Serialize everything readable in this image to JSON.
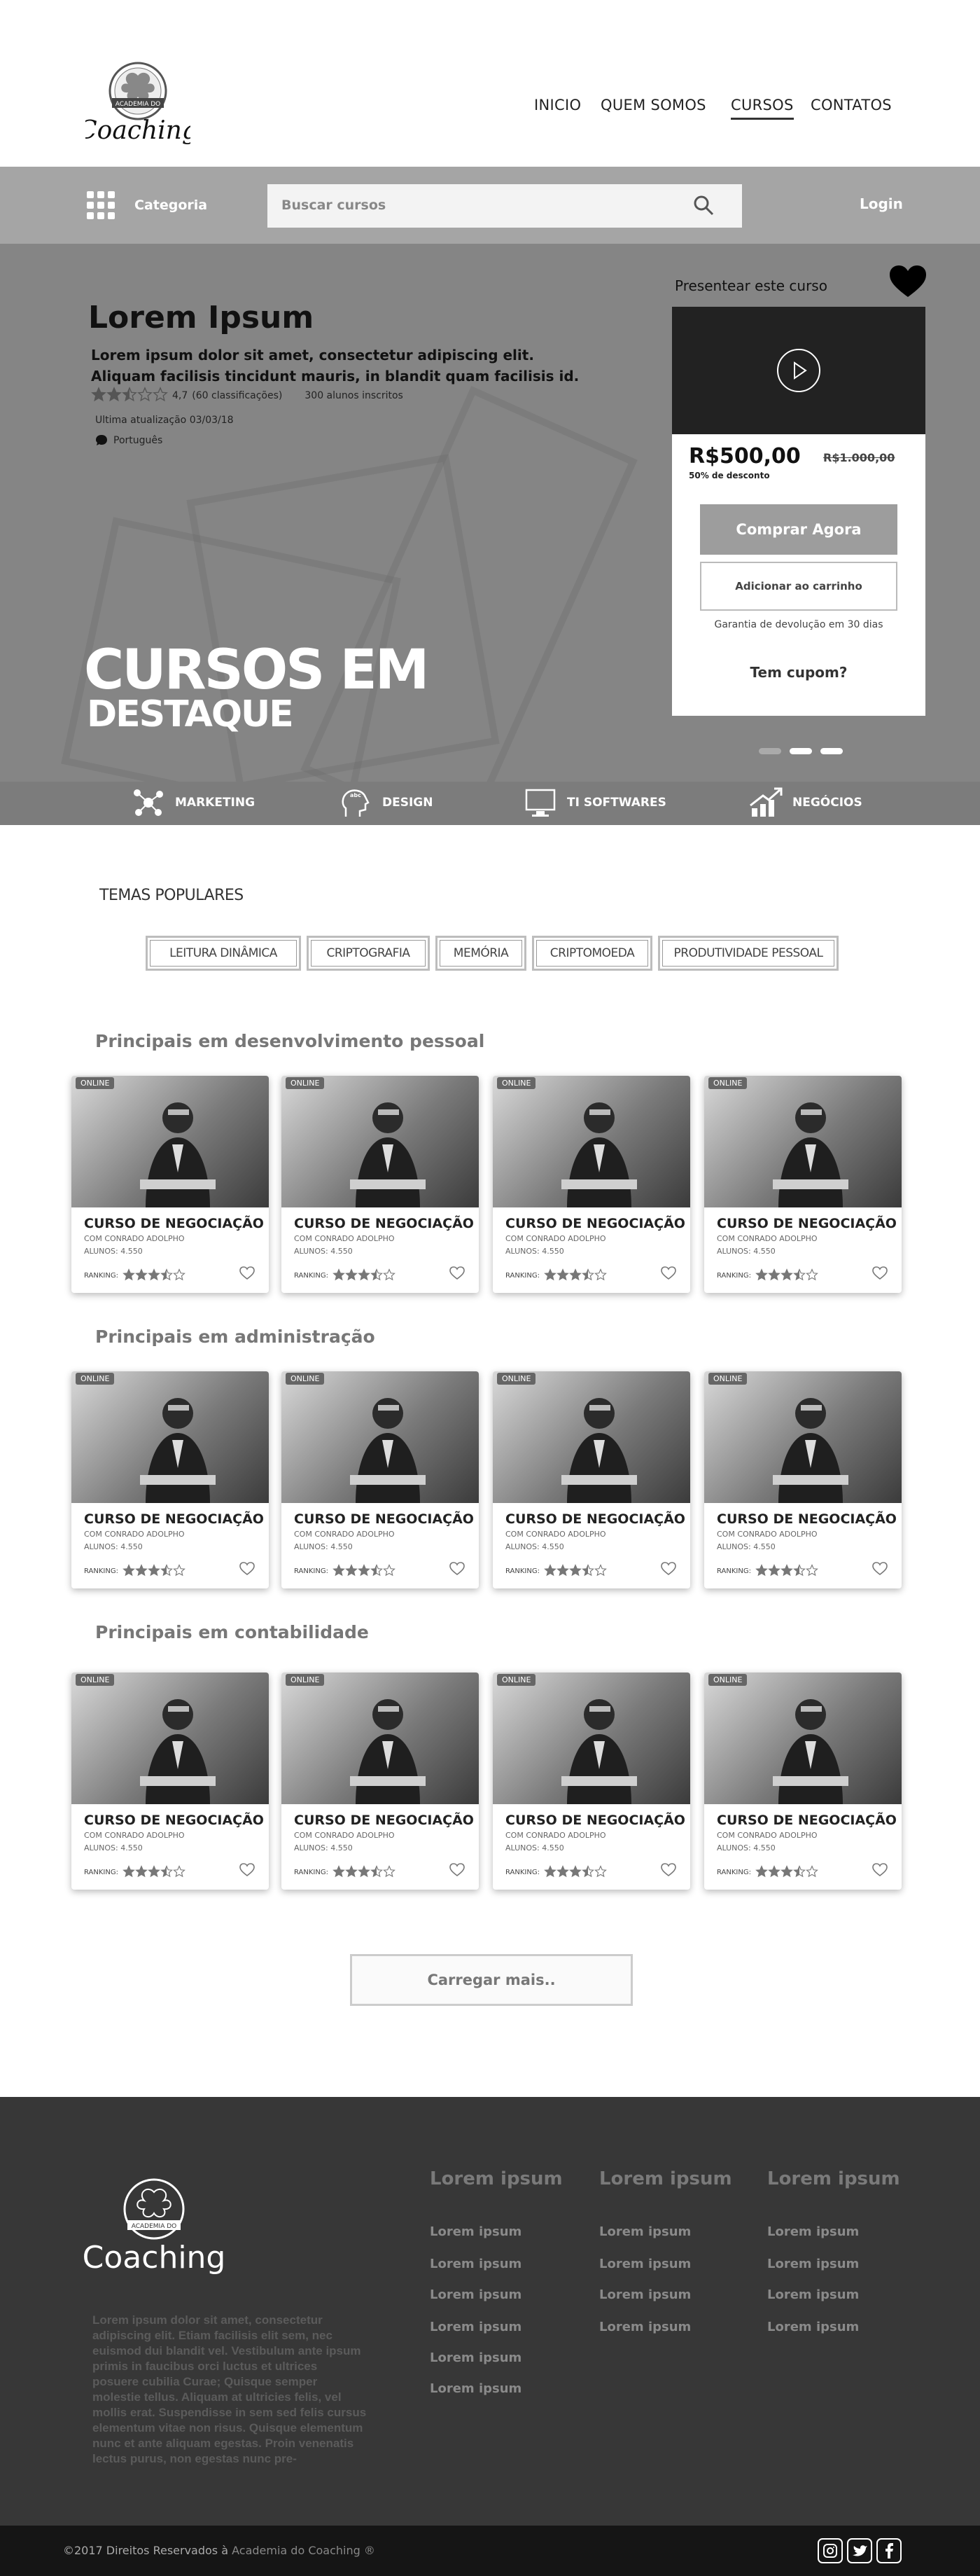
{
  "header": {
    "logo_text": "Coaching",
    "logo_ribbon": "ACADEMIA DO",
    "nav": [
      "INICIO",
      "QUEM SOMOS",
      "CURSOS",
      "CONTATOS"
    ],
    "active_nav": "CURSOS"
  },
  "searchbar": {
    "category_label": "Categoria",
    "search_placeholder": "Buscar cursos",
    "login_label": "Login"
  },
  "hero": {
    "title": "Lorem Ipsum",
    "subtitle": "Lorem ipsum dolor sit amet, consectetur adipiscing elit. Aliquam facilisis tincidunt mauris, in blandit quam facilisis id.",
    "rating_value": "4,7",
    "rating_count": "(60 classificações)",
    "students": "300 alunos inscritos",
    "stars": 2.5,
    "updated": "Ultima atualização 03/03/18",
    "language": "Português",
    "banner_line1": "CURSOS EM",
    "banner_line2": "DESTAQUE"
  },
  "purchase": {
    "gift_label": "Presentear este curso",
    "price": "R$500,00",
    "old_price": "R$1.000,00",
    "discount": "50% de desconto",
    "buy_button": "Comprar Agora",
    "cart_button": "Adicionar ao carrinho",
    "guarantee": "Garantia de devolução em 30 dias",
    "coupon": "Tem cupom?"
  },
  "categories": [
    "MARKETING",
    "DESIGN",
    "TI SOFTWARES",
    "NEGÓCIOS"
  ],
  "popular": {
    "title": "TEMAS POPULARES",
    "tags": [
      "LEITURA DINÂMICA",
      "CRIPTOGRAFIA",
      "MEMÓRIA",
      "CRIPTOMOEDA",
      "PRODUTIVIDADE PESSOAL"
    ]
  },
  "sections": [
    {
      "title": "Principais em desenvolvimento pessoal"
    },
    {
      "title": "Principais em administração"
    },
    {
      "title": "Principais em contabilidade"
    }
  ],
  "course": {
    "badge": "ONLINE",
    "title": "CURSO DE NEGOCIAÇÃO",
    "teacher": "COM CONRADO ADOLPHO",
    "students": "ALUNOS: 4.550",
    "ranking_label": "RANKING:",
    "stars": 3.5
  },
  "load_more": "Carregar mais..",
  "footer": {
    "logo_text": "Coaching",
    "logo_ribbon": "ACADEMIA DO",
    "description": "Lorem ipsum dolor sit amet, consectetur adipiscing elit. Etiam facilisis elit sem, nec euismod dui blandit vel. Vestibulum ante ipsum primis in faucibus orci luctus et ultrices posuere cubilia Curae; Quisque semper molestie tellus. Aliquam at ultricies felis, vel mollis erat. Suspendisse in sem sed felis cursus elementum vitae non risus. Quisque elementum nunc et ante aliquam egestas. Proin venenatis lectus purus, non egestas nunc pre-",
    "columns": [
      {
        "title": "Lorem ipsum",
        "links": [
          "Lorem ipsum",
          "Lorem ipsum",
          "Lorem ipsum",
          "Lorem ipsum",
          "Lorem ipsum",
          "Lorem ipsum"
        ]
      },
      {
        "title": "Lorem ipsum",
        "links": [
          "Lorem ipsum",
          "Lorem ipsum",
          "Lorem ipsum",
          "Lorem ipsum"
        ]
      },
      {
        "title": "Lorem ipsum",
        "links": [
          "Lorem ipsum",
          "Lorem ipsum",
          "Lorem ipsum",
          "Lorem ipsum"
        ]
      }
    ],
    "copyright_prefix": "©2017 Direitos Reservados à ",
    "copyright_brand": "Academia do Coaching ®",
    "social": [
      "instagram-icon",
      "twitter-icon",
      "facebook-icon"
    ]
  },
  "colors": {
    "header_bar": "#a5a5a5",
    "hero": "#858585",
    "strip": "#7c7c7c",
    "footer": "#373737",
    "bottom": "#151515"
  }
}
